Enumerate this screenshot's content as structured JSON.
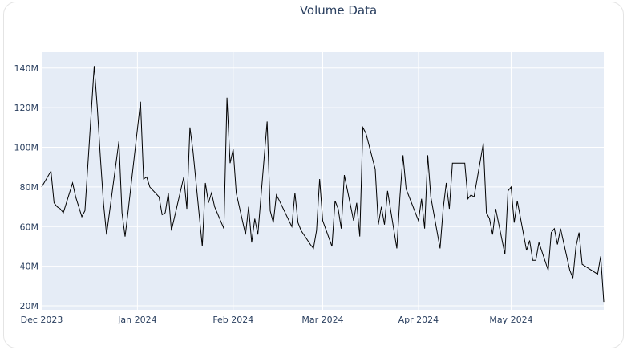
{
  "chart_data": {
    "type": "line",
    "title": "Volume Data",
    "xlabel": "",
    "ylabel": "",
    "x_range": [
      "2023-12-01",
      "2024-05-31"
    ],
    "ylim": [
      18000000,
      148000000
    ],
    "grid": true,
    "legend": "none",
    "colors": {
      "line": "#000000",
      "plot_bg": "#e5ecf6",
      "grid": "#ffffff",
      "text": "#2a3f5f"
    },
    "y_ticks": [
      {
        "value": 20000000,
        "label": "20M"
      },
      {
        "value": 40000000,
        "label": "40M"
      },
      {
        "value": 60000000,
        "label": "60M"
      },
      {
        "value": 80000000,
        "label": "80M"
      },
      {
        "value": 100000000,
        "label": "100M"
      },
      {
        "value": 120000000,
        "label": "120M"
      },
      {
        "value": 140000000,
        "label": "140M"
      }
    ],
    "x_ticks": [
      {
        "value": "2023-12-01",
        "label": "Dec 2023"
      },
      {
        "value": "2024-01-01",
        "label": "Jan 2024"
      },
      {
        "value": "2024-02-01",
        "label": "Feb 2024"
      },
      {
        "value": "2024-03-01",
        "label": "Mar 2024"
      },
      {
        "value": "2024-04-01",
        "label": "Apr 2024"
      },
      {
        "value": "2024-05-01",
        "label": "May 2024"
      }
    ],
    "series": [
      {
        "x": [
          "2023-12-01",
          "2023-12-04",
          "2023-12-05",
          "2023-12-06",
          "2023-12-07",
          "2023-12-08",
          "2023-12-11",
          "2023-12-12",
          "2023-12-13",
          "2023-12-14",
          "2023-12-15",
          "2023-12-18",
          "2023-12-19",
          "2023-12-20",
          "2023-12-21",
          "2023-12-22",
          "2023-12-26",
          "2023-12-27",
          "2023-12-28",
          "2023-12-29",
          "2024-01-02",
          "2024-01-03",
          "2024-01-04",
          "2024-01-05",
          "2024-01-08",
          "2024-01-09",
          "2024-01-10",
          "2024-01-11",
          "2024-01-12",
          "2024-01-16",
          "2024-01-17",
          "2024-01-18",
          "2024-01-19",
          "2024-01-22",
          "2024-01-23",
          "2024-01-24",
          "2024-01-25",
          "2024-01-26",
          "2024-01-29",
          "2024-01-30",
          "2024-01-31",
          "2024-02-01",
          "2024-02-02",
          "2024-02-05",
          "2024-02-06",
          "2024-02-07",
          "2024-02-08",
          "2024-02-09",
          "2024-02-12",
          "2024-02-13",
          "2024-02-14",
          "2024-02-15",
          "2024-02-16",
          "2024-02-20",
          "2024-02-21",
          "2024-02-22",
          "2024-02-23",
          "2024-02-26",
          "2024-02-27",
          "2024-02-28",
          "2024-02-29",
          "2024-03-01",
          "2024-03-04",
          "2024-03-05",
          "2024-03-06",
          "2024-03-07",
          "2024-03-08",
          "2024-03-11",
          "2024-03-12",
          "2024-03-13",
          "2024-03-14",
          "2024-03-15",
          "2024-03-18",
          "2024-03-19",
          "2024-03-20",
          "2024-03-21",
          "2024-03-22",
          "2024-03-25",
          "2024-03-26",
          "2024-03-27",
          "2024-03-28",
          "2024-04-01",
          "2024-04-02",
          "2024-04-03",
          "2024-04-04",
          "2024-04-05",
          "2024-04-08",
          "2024-04-09",
          "2024-04-10",
          "2024-04-11",
          "2024-04-12",
          "2024-04-15",
          "2024-04-16",
          "2024-04-17",
          "2024-04-18",
          "2024-04-19",
          "2024-04-22",
          "2024-04-23",
          "2024-04-24",
          "2024-04-25",
          "2024-04-26",
          "2024-04-29",
          "2024-04-30",
          "2024-05-01",
          "2024-05-02",
          "2024-05-03",
          "2024-05-06",
          "2024-05-07",
          "2024-05-08",
          "2024-05-09",
          "2024-05-10",
          "2024-05-13",
          "2024-05-14",
          "2024-05-15",
          "2024-05-16",
          "2024-05-17",
          "2024-05-20",
          "2024-05-21",
          "2024-05-22",
          "2024-05-23",
          "2024-05-24",
          "2024-05-28",
          "2024-05-29",
          "2024-05-30",
          "2024-05-31"
        ],
        "values": [
          80000000,
          88000000,
          72000000,
          70000000,
          69000000,
          67000000,
          82000000,
          75000000,
          70000000,
          65000000,
          68000000,
          141000000,
          120000000,
          95000000,
          72000000,
          56000000,
          103000000,
          67000000,
          55000000,
          68000000,
          123000000,
          84000000,
          85000000,
          80000000,
          75000000,
          66000000,
          67000000,
          77000000,
          58000000,
          85000000,
          69000000,
          110000000,
          98000000,
          50000000,
          82000000,
          72000000,
          77000000,
          70000000,
          59000000,
          125000000,
          92000000,
          99000000,
          77000000,
          56000000,
          70000000,
          52000000,
          64000000,
          56000000,
          113000000,
          68000000,
          62000000,
          76000000,
          73000000,
          60000000,
          77000000,
          62000000,
          58000000,
          51000000,
          49000000,
          58000000,
          84000000,
          63000000,
          50000000,
          73000000,
          69000000,
          59000000,
          86000000,
          63000000,
          72000000,
          55000000,
          110000000,
          107000000,
          89000000,
          61000000,
          70000000,
          61000000,
          78000000,
          49000000,
          75000000,
          96000000,
          79000000,
          63000000,
          74000000,
          59000000,
          96000000,
          75000000,
          49000000,
          69000000,
          82000000,
          69000000,
          92000000,
          92000000,
          92000000,
          74000000,
          76000000,
          75000000,
          102000000,
          67000000,
          64000000,
          56000000,
          69000000,
          46000000,
          78000000,
          80000000,
          62000000,
          73000000,
          48000000,
          53000000,
          43000000,
          43000000,
          52000000,
          38000000,
          57000000,
          59000000,
          51000000,
          59000000,
          38000000,
          34000000,
          50000000,
          57000000,
          41000000,
          37000000,
          36000000,
          45000000,
          22000000
        ]
      }
    ]
  }
}
